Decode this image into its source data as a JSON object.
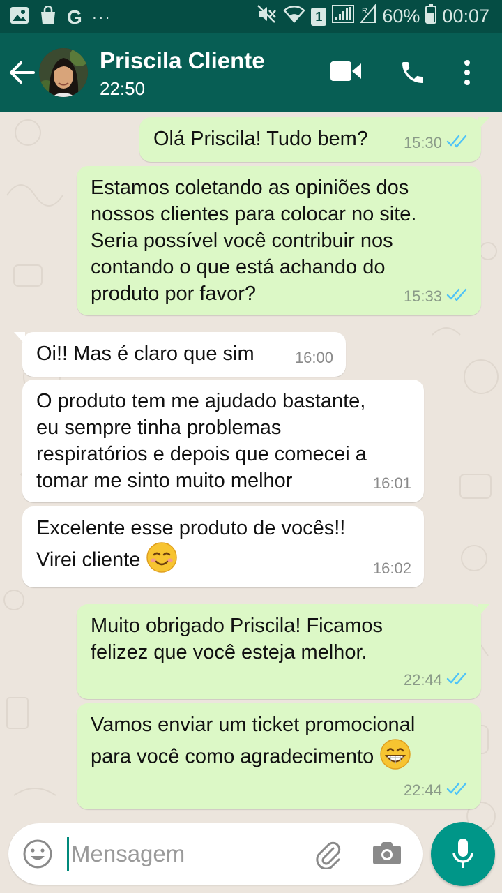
{
  "status_bar": {
    "battery": "60%",
    "time": "00:07",
    "sim": "1",
    "left_icons": [
      "image-icon",
      "shopping-bag-icon",
      "google-icon",
      "more-dots-icon"
    ],
    "google_glyph": "G",
    "dots_glyph": "···"
  },
  "header": {
    "contact_name": "Priscila Cliente",
    "contact_status": "22:50"
  },
  "messages": [
    {
      "direction": "out",
      "text": "Olá Priscila! Tudo bem?",
      "time": "15:30",
      "read": true
    },
    {
      "direction": "out",
      "text": "Estamos coletando as opiniões dos\nnossos clientes para colocar no site.\nSeria possível você contribuir nos\ncontando o que está achando do\nproduto por favor?",
      "time": "15:33",
      "read": true
    },
    {
      "direction": "in",
      "text": "Oi!! Mas é claro que sim",
      "time": "16:00"
    },
    {
      "direction": "in",
      "text": "O produto tem me ajudado bastante,\neu sempre tinha problemas\nrespiratórios e depois que comecei a\ntomar me sinto muito melhor",
      "time": "16:01"
    },
    {
      "direction": "in",
      "text": "Excelente esse produto de vocês!!\nVirei cliente",
      "time": "16:02",
      "emoji": "smiling-face-icon"
    },
    {
      "direction": "out",
      "text": "Muito obrigado Priscila! Ficamos\nfelizez que você esteja melhor.",
      "time": "22:44",
      "read": true
    },
    {
      "direction": "out",
      "text": "Vamos enviar um ticket promocional\npara você como agradecimento",
      "time": "22:44",
      "read": true,
      "emoji": "grinning-face-icon"
    }
  ],
  "input": {
    "placeholder": "Mensagem",
    "value": ""
  },
  "colors": {
    "header": "#075e54",
    "status_bar": "#054d44",
    "outgoing_bubble": "#dcf8c6",
    "incoming_bubble": "#ffffff",
    "chat_background": "#ece5dd",
    "read_ticks": "#4fc3f7",
    "fab": "#009688"
  }
}
